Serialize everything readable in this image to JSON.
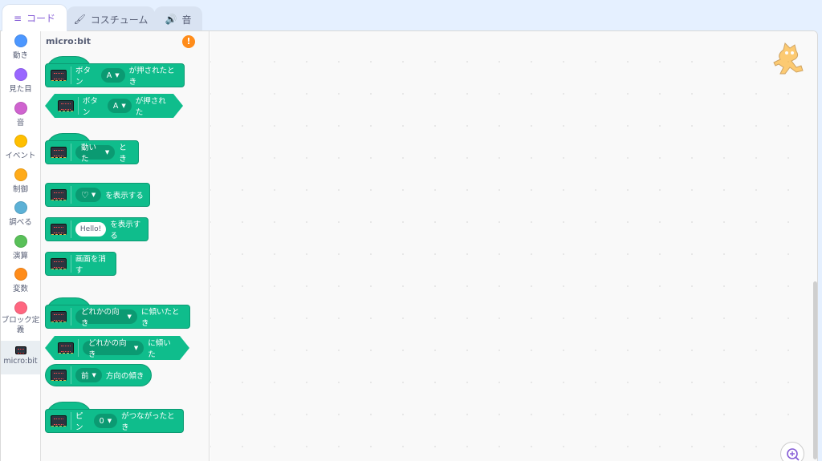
{
  "tabs": [
    {
      "label": "コード",
      "icon": "code-icon"
    },
    {
      "label": "コスチューム",
      "icon": "brush-icon"
    },
    {
      "label": "音",
      "icon": "speaker-icon"
    }
  ],
  "categories": [
    {
      "label": "動き",
      "color": "#4c97ff"
    },
    {
      "label": "見た目",
      "color": "#9966ff"
    },
    {
      "label": "音",
      "color": "#cf63cf"
    },
    {
      "label": "イベント",
      "color": "#ffbf00"
    },
    {
      "label": "制御",
      "color": "#ffab19"
    },
    {
      "label": "調べる",
      "color": "#5cb1d6"
    },
    {
      "label": "演算",
      "color": "#59c059"
    },
    {
      "label": "変数",
      "color": "#ff8c1a"
    },
    {
      "label": "ブロック定義",
      "label_line1": "ブロック定",
      "label_line2": "義",
      "color": "#ff6680"
    },
    {
      "label": "micro:bit",
      "color": "#0fbd8c"
    }
  ],
  "flyout": {
    "title": "micro:bit",
    "warning": "!",
    "blocks": {
      "button_hat": {
        "pre": "ボタン",
        "dd": "A",
        "post": "が押されたとき"
      },
      "button_bool": {
        "pre": "ボタン",
        "dd": "A",
        "post": "が押された"
      },
      "gesture_hat": {
        "dd": "動いた",
        "post": "とき"
      },
      "display_sym": {
        "post": "を表示する"
      },
      "display_text": {
        "value": "Hello!",
        "post": "を表示する"
      },
      "clear": {
        "label": "画面を消す"
      },
      "tilt_hat": {
        "dd": "どれかの向き",
        "post": "に傾いたとき"
      },
      "tilt_bool": {
        "dd": "どれかの向き",
        "post": "に傾いた"
      },
      "tilt_reporter": {
        "dd": "前",
        "post": "方向の傾き"
      },
      "pin_hat": {
        "pre": "ピン",
        "dd": "0",
        "post": "がつながったとき"
      }
    }
  }
}
